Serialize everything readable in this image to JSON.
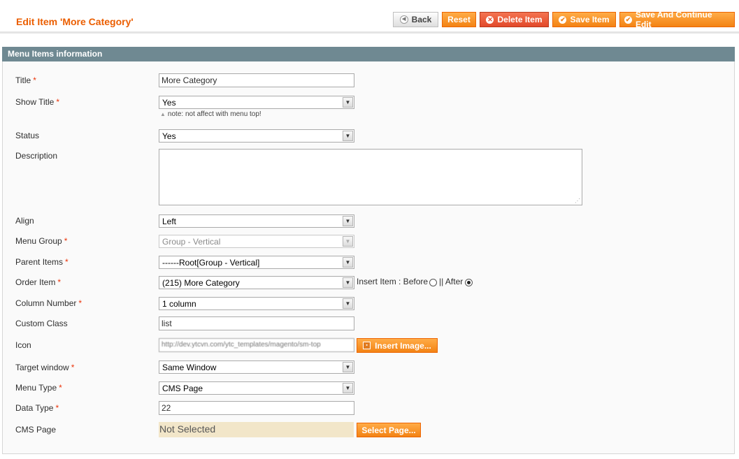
{
  "header": {
    "title": "Edit Item 'More Category'",
    "buttons": {
      "back": "Back",
      "reset": "Reset",
      "delete": "Delete Item",
      "save": "Save Item",
      "save_continue": "Save And Continue Edit"
    }
  },
  "section": {
    "title": "Menu Items information"
  },
  "fields": {
    "title": {
      "label": "Title",
      "required": "*",
      "value": "More Category"
    },
    "show_title": {
      "label": "Show Title",
      "required": "*",
      "value": "Yes",
      "note": "note: not affect with menu top!"
    },
    "status": {
      "label": "Status",
      "value": "Yes"
    },
    "description": {
      "label": "Description",
      "value": ""
    },
    "align": {
      "label": "Align",
      "value": "Left"
    },
    "menu_group": {
      "label": "Menu Group",
      "required": "*",
      "value": "Group - Vertical"
    },
    "parent_items": {
      "label": "Parent Items",
      "required": "*",
      "value": "------Root[Group - Vertical]"
    },
    "order_item": {
      "label": "Order Item",
      "required": "*",
      "value": "(215) More Category",
      "insert_label": "Insert Item : Before",
      "after_label": "|| After",
      "selected": "after"
    },
    "column_number": {
      "label": "Column Number",
      "required": "*",
      "value": "1 column"
    },
    "custom_class": {
      "label": "Custom Class",
      "value": "list"
    },
    "icon": {
      "label": "Icon",
      "value": "http://dev.ytcvn.com/ytc_templates/magento/sm-top",
      "button": "Insert Image..."
    },
    "target_window": {
      "label": "Target window",
      "required": "*",
      "value": "Same Window"
    },
    "menu_type": {
      "label": "Menu Type",
      "required": "*",
      "value": "CMS Page"
    },
    "data_type": {
      "label": "Data Type",
      "required": "*",
      "value": "22"
    },
    "cms_page": {
      "label": "CMS Page",
      "value": "Not Selected",
      "button": "Select Page..."
    }
  },
  "colors": {
    "accent": "#eb5e00",
    "section_header": "#6f8992",
    "button_orange": "#f38314",
    "button_red": "#e2492a"
  }
}
